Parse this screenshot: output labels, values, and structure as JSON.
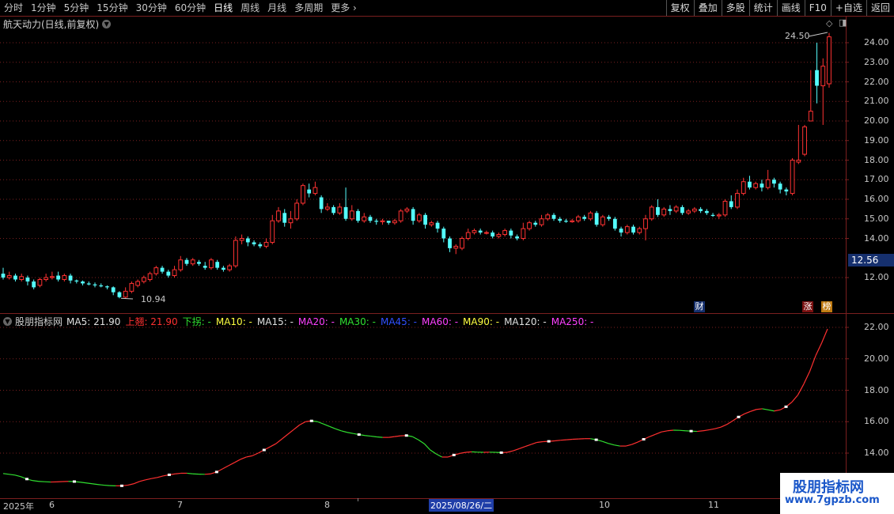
{
  "toolbar": {
    "periods": [
      "分时",
      "1分钟",
      "5分钟",
      "15分钟",
      "30分钟",
      "60分钟",
      "日线",
      "周线",
      "月线",
      "多周期",
      "更多"
    ],
    "active_period": "日线",
    "more_label": "更多",
    "right_buttons": [
      "复权",
      "叠加",
      "多股",
      "统计",
      "画线",
      "F10",
      "+自选",
      "返回"
    ]
  },
  "stock": {
    "title": "航天动力(日线,前复权)",
    "high_label": "24.50",
    "low_label": "10.94",
    "last_price": "12.56"
  },
  "price_axis": [
    "24.00",
    "23.00",
    "22.00",
    "21.00",
    "20.00",
    "19.00",
    "18.00",
    "17.00",
    "16.00",
    "15.00",
    "14.00",
    "12.00"
  ],
  "indicator": {
    "name": "股朋指标网",
    "items": [
      {
        "label": "MA5: 21.90",
        "color": "#e0e0e0"
      },
      {
        "label": "上翘: 21.90",
        "color": "#ff3030"
      },
      {
        "label": "下拐: -",
        "color": "#30e030"
      },
      {
        "label": "MA10: -",
        "color": "#ffff40"
      },
      {
        "label": "MA15: -",
        "color": "#e0e0e0"
      },
      {
        "label": "MA20: -",
        "color": "#ff40ff"
      },
      {
        "label": "MA30: -",
        "color": "#30e030"
      },
      {
        "label": "MA45: -",
        "color": "#3050ff"
      },
      {
        "label": "MA60: -",
        "color": "#ff40ff"
      },
      {
        "label": "MA90: -",
        "color": "#ffff40"
      },
      {
        "label": "MA120: -",
        "color": "#e0e0e0"
      },
      {
        "label": "MA250: -",
        "color": "#ff40ff"
      }
    ],
    "axis": [
      "22.00",
      "20.00",
      "18.00",
      "16.00",
      "14.00"
    ]
  },
  "dates": {
    "labels": [
      "2025年",
      "6",
      "7",
      "8",
      "10",
      "11"
    ],
    "highlight": "2025/08/26/二"
  },
  "badges": {
    "cai": "财",
    "zhang": "涨",
    "bang": "榜"
  },
  "watermark": {
    "title": "股朋指标网",
    "url": "www.7gpzb.com"
  },
  "colors": {
    "up": "#ff3232",
    "down": "#54fcfc",
    "grid": "#7a1f1f",
    "ma_up": "#ff3030",
    "ma_down": "#30e030"
  },
  "chart_data": {
    "type": "candlestick",
    "candles": [
      [
        12.2,
        12.0,
        12.5,
        11.9
      ],
      [
        12.0,
        12.1,
        12.3,
        11.9
      ],
      [
        12.1,
        11.9,
        12.2,
        11.8
      ],
      [
        11.9,
        12.05,
        12.2,
        11.8
      ],
      [
        12.0,
        11.8,
        12.1,
        11.6
      ],
      [
        11.8,
        11.5,
        11.9,
        11.4
      ],
      [
        11.6,
        11.9,
        12.0,
        11.5
      ],
      [
        11.9,
        12.0,
        12.2,
        11.8
      ],
      [
        12.0,
        12.05,
        12.3,
        11.9
      ],
      [
        12.1,
        11.9,
        12.3,
        11.8
      ],
      [
        11.9,
        12.1,
        12.2,
        11.8
      ],
      [
        12.1,
        11.85,
        12.2,
        11.7
      ],
      [
        11.85,
        11.8,
        11.9,
        11.7
      ],
      [
        11.8,
        11.7,
        11.85,
        11.6
      ],
      [
        11.7,
        11.65,
        11.8,
        11.6
      ],
      [
        11.65,
        11.6,
        11.75,
        11.5
      ],
      [
        11.6,
        11.55,
        11.7,
        11.5
      ],
      [
        11.55,
        11.5,
        11.6,
        11.4
      ],
      [
        11.5,
        11.25,
        11.55,
        11.1
      ],
      [
        11.25,
        11.0,
        11.3,
        10.94
      ],
      [
        11.0,
        11.3,
        11.5,
        10.95
      ],
      [
        11.3,
        11.7,
        11.8,
        11.2
      ],
      [
        11.6,
        11.8,
        11.9,
        11.5
      ],
      [
        11.8,
        12.0,
        12.1,
        11.7
      ],
      [
        11.9,
        12.2,
        12.3,
        11.8
      ],
      [
        12.2,
        12.5,
        12.6,
        12.1
      ],
      [
        12.5,
        12.3,
        12.6,
        12.2
      ],
      [
        12.3,
        12.1,
        12.4,
        12.0
      ],
      [
        12.1,
        12.4,
        12.6,
        12.0
      ],
      [
        12.4,
        12.9,
        13.1,
        12.3
      ],
      [
        12.9,
        12.7,
        13.0,
        12.6
      ],
      [
        12.7,
        12.9,
        13.0,
        12.6
      ],
      [
        12.8,
        12.7,
        12.9,
        12.6
      ],
      [
        12.6,
        12.5,
        12.8,
        12.4
      ],
      [
        12.5,
        12.9,
        13.0,
        12.4
      ],
      [
        12.8,
        12.5,
        12.9,
        12.4
      ],
      [
        12.5,
        12.4,
        12.6,
        12.3
      ],
      [
        12.4,
        12.6,
        12.7,
        12.3
      ],
      [
        12.6,
        13.9,
        14.1,
        12.5
      ],
      [
        13.9,
        14.0,
        14.2,
        13.7
      ],
      [
        14.0,
        13.8,
        14.1,
        13.6
      ],
      [
        13.8,
        13.7,
        13.9,
        13.6
      ],
      [
        13.7,
        13.6,
        13.8,
        13.5
      ],
      [
        13.6,
        13.8,
        14.0,
        13.5
      ],
      [
        13.8,
        14.9,
        15.2,
        13.7
      ],
      [
        14.9,
        15.4,
        15.6,
        14.8
      ],
      [
        15.3,
        14.8,
        15.5,
        14.6
      ],
      [
        14.8,
        15.0,
        15.4,
        14.5
      ],
      [
        15.0,
        15.8,
        16.0,
        14.9
      ],
      [
        15.8,
        16.7,
        16.8,
        15.7
      ],
      [
        16.5,
        16.3,
        16.8,
        16.1
      ],
      [
        16.3,
        16.6,
        16.9,
        16.2
      ],
      [
        16.1,
        15.5,
        16.2,
        15.3
      ],
      [
        15.5,
        15.6,
        15.8,
        15.4
      ],
      [
        15.6,
        15.3,
        15.7,
        15.2
      ],
      [
        15.3,
        15.6,
        15.8,
        15.2
      ],
      [
        15.6,
        15.0,
        16.6,
        14.9
      ],
      [
        15.0,
        15.4,
        15.7,
        14.9
      ],
      [
        15.4,
        14.9,
        15.5,
        14.8
      ],
      [
        14.9,
        15.1,
        15.3,
        14.8
      ],
      [
        15.1,
        14.9,
        15.2,
        14.8
      ],
      [
        14.9,
        14.85,
        15.0,
        14.7
      ],
      [
        14.85,
        14.9,
        15.0,
        14.7
      ],
      [
        14.9,
        14.8,
        14.9,
        14.7
      ],
      [
        14.8,
        14.9,
        15.0,
        14.7
      ],
      [
        14.9,
        15.4,
        15.5,
        14.8
      ],
      [
        15.4,
        15.5,
        15.6,
        15.3
      ],
      [
        15.5,
        14.9,
        15.6,
        14.7
      ],
      [
        14.9,
        15.2,
        15.3,
        14.8
      ],
      [
        15.2,
        14.7,
        15.3,
        14.5
      ],
      [
        14.7,
        14.8,
        14.9,
        14.6
      ],
      [
        14.8,
        14.5,
        14.9,
        14.3
      ],
      [
        14.5,
        14.0,
        14.6,
        13.8
      ],
      [
        14.0,
        13.5,
        14.1,
        13.3
      ],
      [
        13.5,
        13.6,
        13.7,
        13.2
      ],
      [
        13.5,
        14.0,
        14.1,
        13.4
      ],
      [
        14.0,
        14.3,
        14.5,
        13.9
      ],
      [
        14.3,
        14.4,
        14.5,
        14.2
      ],
      [
        14.4,
        14.3,
        14.5,
        14.2
      ],
      [
        14.3,
        14.3,
        14.4,
        14.2
      ],
      [
        14.3,
        14.1,
        14.4,
        14.0
      ],
      [
        14.1,
        14.2,
        14.3,
        14.0
      ],
      [
        14.2,
        14.4,
        14.5,
        14.1
      ],
      [
        14.4,
        14.15,
        14.5,
        14.0
      ],
      [
        14.1,
        14.0,
        14.2,
        13.9
      ],
      [
        14.0,
        14.5,
        14.8,
        13.9
      ],
      [
        14.5,
        14.8,
        14.9,
        14.4
      ],
      [
        14.8,
        14.7,
        14.9,
        14.6
      ],
      [
        14.7,
        15.0,
        15.2,
        14.6
      ],
      [
        15.0,
        15.2,
        15.3,
        14.9
      ],
      [
        15.2,
        15.0,
        15.3,
        14.9
      ],
      [
        15.0,
        14.9,
        15.1,
        14.8
      ],
      [
        14.9,
        14.85,
        15.0,
        14.8
      ],
      [
        14.85,
        14.9,
        15.0,
        14.8
      ],
      [
        14.9,
        15.1,
        15.2,
        14.8
      ],
      [
        15.1,
        15.0,
        15.2,
        14.9
      ],
      [
        15.0,
        15.3,
        15.4,
        14.9
      ],
      [
        15.3,
        14.7,
        15.4,
        14.6
      ],
      [
        14.7,
        15.1,
        15.2,
        14.6
      ],
      [
        15.1,
        15.0,
        15.2,
        14.9
      ],
      [
        15.0,
        14.5,
        15.1,
        14.4
      ],
      [
        14.5,
        14.3,
        14.6,
        14.1
      ],
      [
        14.3,
        14.6,
        14.7,
        14.2
      ],
      [
        14.6,
        14.3,
        14.7,
        14.2
      ],
      [
        14.3,
        14.5,
        14.6,
        14.2
      ],
      [
        14.5,
        15.0,
        15.2,
        13.9
      ],
      [
        15.0,
        15.6,
        15.7,
        14.9
      ],
      [
        15.6,
        15.2,
        16.0,
        15.1
      ],
      [
        15.2,
        15.5,
        15.6,
        15.1
      ],
      [
        15.5,
        15.4,
        15.7,
        15.2
      ],
      [
        15.4,
        15.6,
        15.7,
        15.3
      ],
      [
        15.6,
        15.3,
        15.7,
        15.2
      ],
      [
        15.3,
        15.4,
        15.5,
        15.2
      ],
      [
        15.4,
        15.5,
        15.6,
        15.3
      ],
      [
        15.5,
        15.4,
        15.6,
        15.3
      ],
      [
        15.4,
        15.3,
        15.5,
        15.2
      ],
      [
        15.2,
        15.15,
        15.3,
        15.1
      ],
      [
        15.15,
        15.2,
        15.3,
        15.0
      ],
      [
        15.2,
        15.9,
        16.0,
        15.1
      ],
      [
        15.9,
        15.6,
        16.2,
        15.5
      ],
      [
        15.6,
        16.3,
        16.5,
        15.5
      ],
      [
        16.3,
        16.9,
        17.1,
        16.2
      ],
      [
        16.9,
        16.6,
        17.2,
        16.5
      ],
      [
        16.6,
        16.8,
        16.9,
        16.5
      ],
      [
        16.8,
        16.6,
        17.0,
        16.4
      ],
      [
        16.6,
        17.0,
        17.5,
        16.5
      ],
      [
        17.0,
        16.8,
        17.1,
        16.6
      ],
      [
        16.8,
        16.5,
        16.9,
        16.3
      ],
      [
        16.5,
        16.4,
        16.6,
        16.2
      ],
      [
        16.3,
        18.0,
        18.1,
        16.2
      ],
      [
        17.9,
        18.0,
        19.8,
        17.8
      ],
      [
        18.3,
        19.7,
        19.8,
        18.2
      ],
      [
        20.0,
        20.5,
        22.6,
        20.3
      ],
      [
        22.6,
        21.8,
        24.0,
        20.9
      ],
      [
        21.8,
        22.8,
        23.2,
        19.8
      ],
      [
        21.9,
        24.3,
        24.5,
        21.7
      ]
    ],
    "high": 24.5,
    "low": 10.94,
    "ylim": [
      10.9,
      24.6
    ],
    "ma_line": [
      12.7,
      12.65,
      12.6,
      12.5,
      12.35,
      12.25,
      12.2,
      12.18,
      12.16,
      12.17,
      12.19,
      12.2,
      12.19,
      12.15,
      12.1,
      12.05,
      12.0,
      11.96,
      11.93,
      11.92,
      11.92,
      11.96,
      12.05,
      12.2,
      12.3,
      12.38,
      12.45,
      12.55,
      12.62,
      12.68,
      12.72,
      12.72,
      12.68,
      12.66,
      12.65,
      12.68,
      12.8,
      13.0,
      13.2,
      13.4,
      13.6,
      13.75,
      13.83,
      14.0,
      14.2,
      14.4,
      14.6,
      14.9,
      15.2,
      15.5,
      15.8,
      16.0,
      16.05,
      16.0,
      15.85,
      15.7,
      15.55,
      15.42,
      15.32,
      15.25,
      15.18,
      15.12,
      15.08,
      15.03,
      15.0,
      15.0,
      15.05,
      15.1,
      15.12,
      15.05,
      14.85,
      14.6,
      14.2,
      13.95,
      13.75,
      13.75,
      13.88,
      13.98,
      14.05,
      14.08,
      14.06,
      14.05,
      14.06,
      14.05,
      14.03,
      14.05,
      14.15,
      14.28,
      14.42,
      14.55,
      14.68,
      14.73,
      14.75,
      14.78,
      14.82,
      14.85,
      14.88,
      14.9,
      14.92,
      14.92,
      14.85,
      14.75,
      14.62,
      14.52,
      14.45,
      14.45,
      14.55,
      14.7,
      14.88,
      15.05,
      15.2,
      15.35,
      15.42,
      15.46,
      15.45,
      15.42,
      15.4,
      15.38,
      15.42,
      15.48,
      15.55,
      15.65,
      15.82,
      16.05,
      16.3,
      16.5,
      16.65,
      16.78,
      16.82,
      16.75,
      16.68,
      16.75,
      16.95,
      17.25,
      17.7,
      18.4,
      19.2,
      20.2,
      21.0,
      21.9
    ]
  }
}
